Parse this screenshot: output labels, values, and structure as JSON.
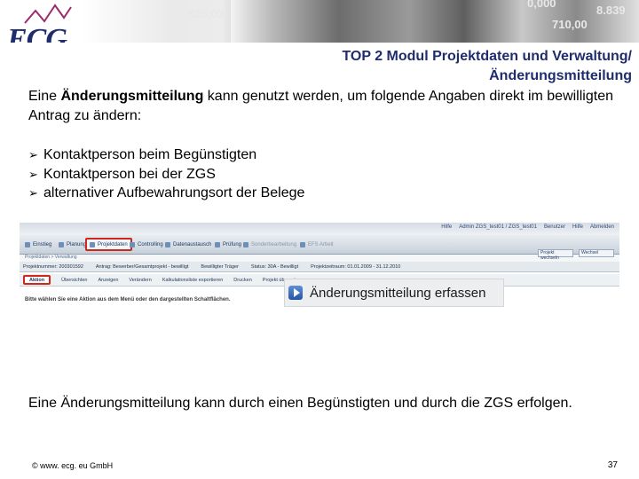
{
  "header": {
    "logo_text": "ECG",
    "banner_numbers": [
      "825,00",
      "0,000",
      "710,00",
      "8.839"
    ]
  },
  "slide": {
    "title_line1": "TOP 2 Modul Projektdaten und Verwaltung/",
    "title_line2": "Änderungsmitteilung",
    "intro_prefix": "Eine ",
    "intro_bold": "Änderungsmitteilung",
    "intro_rest": " kann genutzt werden, um folgende Angaben direkt im bewilligten Antrag  zu ändern:",
    "bullets": [
      "Kontaktperson beim Begünstigten",
      "Kontaktperson bei der ZGS",
      "alternativer Aufbewahrungsort der Belege"
    ],
    "closing": "Eine Änderungsmitteilung kann durch einen Begünstigten und durch die ZGS erfolgen.",
    "footer_left": "© www. ecg. eu GmbH",
    "page_number": "37"
  },
  "screenshot": {
    "top_links": [
      "Hilfe",
      "Admin ZGS_test01 / ZGS_test01",
      "Benutzer",
      "Hilfe",
      "Abmelden"
    ],
    "tabs": [
      "Einstieg",
      "Planung",
      "Projektdaten",
      "Controlling",
      "Datenaustausch",
      "Prüfung",
      "Sonderbearbeitung",
      "EFS Arbeit"
    ],
    "sub_path": "Projektdaten > Verwaltung",
    "info": [
      "Projektnummer: 200301592",
      "Antrag: Bewerber/Gesamtprojekt - bewilligt",
      "Bewilligter Träger",
      "Status: 30A - Bewilligt",
      "Projektzeitraum: 01.01.2009 - 31.12.2010"
    ],
    "right_buttons": [
      "Projekt wechseln",
      "Wechsel"
    ],
    "actions": [
      "Aktion",
      "Übersichten",
      "Anzeigen",
      "Verändern",
      "Kalkulationsliste exportieren",
      "Drucken",
      "Projekt übersetzen"
    ],
    "hint": "Bitte wählen Sie eine Aktion aus dem Menü oder den dargestellten Schaltflächen."
  },
  "callout": {
    "label": "Änderungsmitteilung erfassen"
  }
}
